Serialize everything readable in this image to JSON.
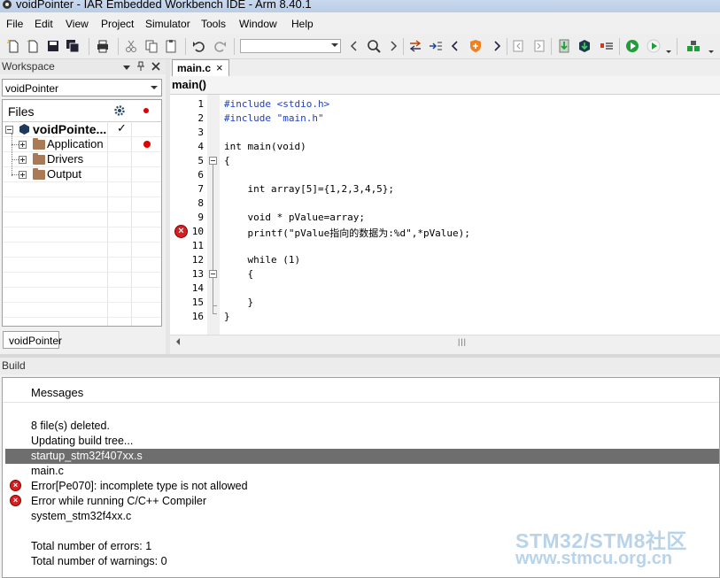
{
  "window": {
    "title": "voidPointer - IAR Embedded Workbench IDE - Arm 8.40.1"
  },
  "menu": {
    "items": [
      "File",
      "Edit",
      "View",
      "Project",
      "Simulator",
      "Tools",
      "Window",
      "Help"
    ]
  },
  "toolbar": {
    "buttons": [
      "new-file",
      "open",
      "save",
      "save-all",
      "print",
      "cut",
      "copy",
      "paste",
      "undo",
      "redo",
      "find",
      "find-previous",
      "find-next",
      "toggle-bookmark",
      "previous-bookmark",
      "next-bookmark",
      "go-back",
      "go-forward",
      "compile",
      "make",
      "stop-build",
      "debug",
      "download-debug",
      "debug-options"
    ],
    "search_value": ""
  },
  "workspace": {
    "header": "Workspace",
    "selected_config": "voidPointer",
    "files_header": "Files",
    "tree": [
      {
        "label": "voidPointe...",
        "check": "✓"
      },
      {
        "label": "Application"
      },
      {
        "label": "Drivers"
      },
      {
        "label": "Output"
      }
    ],
    "tab": "voidPointer"
  },
  "editor": {
    "tab_name": "main.c",
    "tab_close": "×",
    "function": "main()",
    "lines": [
      {
        "n": "1",
        "text": "#include <stdio.h>"
      },
      {
        "n": "2",
        "text": "#include \"main.h\""
      },
      {
        "n": "3",
        "text": ""
      },
      {
        "n": "4",
        "text": "int main(void)"
      },
      {
        "n": "5",
        "text": "{"
      },
      {
        "n": "6",
        "text": ""
      },
      {
        "n": "7",
        "text": "    int array[5]={1,2,3,4,5};"
      },
      {
        "n": "8",
        "text": ""
      },
      {
        "n": "9",
        "text": "    void * pValue=array;"
      },
      {
        "n": "10",
        "text": "    printf(\"pValue指向的数据为:%d\",*pValue);"
      },
      {
        "n": "11",
        "text": ""
      },
      {
        "n": "12",
        "text": "    while (1)"
      },
      {
        "n": "13",
        "text": "    {"
      },
      {
        "n": "14",
        "text": ""
      },
      {
        "n": "15",
        "text": "    }"
      },
      {
        "n": "16",
        "text": "}"
      }
    ],
    "error_line": "10"
  },
  "build": {
    "header": "Build",
    "messages_header": "Messages",
    "messages": [
      {
        "text": "8  file(s) deleted.",
        "type": "info"
      },
      {
        "text": "Updating build tree...",
        "type": "info"
      },
      {
        "text": "startup_stm32f407xx.s",
        "type": "selected"
      },
      {
        "text": "main.c",
        "type": "info"
      },
      {
        "text": "Error[Pe070]: incomplete type is not allowed",
        "type": "error"
      },
      {
        "text": "Error while running C/C++ Compiler",
        "type": "error"
      },
      {
        "text": "system_stm32f4xx.c",
        "type": "info"
      },
      {
        "text": "",
        "type": "blank"
      },
      {
        "text": "Total number of errors: 1",
        "type": "info"
      },
      {
        "text": "Total number of warnings: 0",
        "type": "info"
      }
    ]
  },
  "watermark": {
    "line1": "STM32/STM8社区",
    "line2": "www.stmcu.org.cn"
  },
  "colors": {
    "error": "#d81e1e",
    "selection": "#6e6e6e",
    "preprocessor": "#1f3fbf",
    "build_green": "#1f9e3a"
  }
}
